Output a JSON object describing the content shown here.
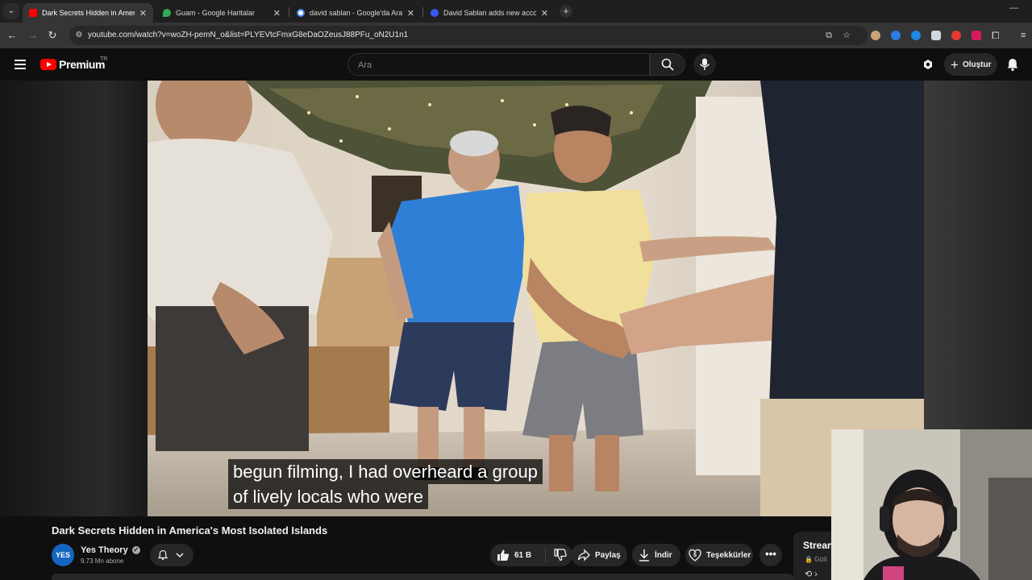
{
  "browser": {
    "tabs": [
      {
        "title": "Dark Secrets Hidden in America's",
        "favicon": "youtube-favicon",
        "active": true
      },
      {
        "title": "Guam - Google Haritalar",
        "favicon": "google-maps-favicon",
        "active": false
      },
      {
        "title": "david sablan - Google'da Ara",
        "favicon": "google-favicon",
        "active": false
      },
      {
        "title": "David Sablan adds new accoun",
        "favicon": "wordpress-favicon",
        "active": false
      }
    ],
    "url": "youtube.com/watch?v=woZH-pemN_o&list=PLYEVtcFmxG8eDaOZeusJ88PFu_oN2U1n1"
  },
  "yt_header": {
    "logo_text": "Premium",
    "logo_superscript": "TR",
    "search_placeholder": "Ara",
    "create_label": "Oluştur"
  },
  "video": {
    "subtitle_lines": [
      "begun filming, I had overheard a group",
      "of lively locals who were"
    ]
  },
  "info": {
    "title": "Dark Secrets Hidden in America's Most Isolated Islands",
    "channel_name": "Yes Theory",
    "channel_avatar_text": "YES",
    "subscribers": "9,73 Mn abone",
    "likes": "61 B",
    "share_label": "Paylaş",
    "download_label": "İndir",
    "thanks_label": "Teşekkürler",
    "more_label": "•••"
  },
  "sidebar_card": {
    "title": "Strean",
    "subtitle": "🔒 Gizli"
  },
  "colors": {
    "brand_red": "#ff0000",
    "bg": "#0f0f0f",
    "pill_bg": "#272727"
  }
}
